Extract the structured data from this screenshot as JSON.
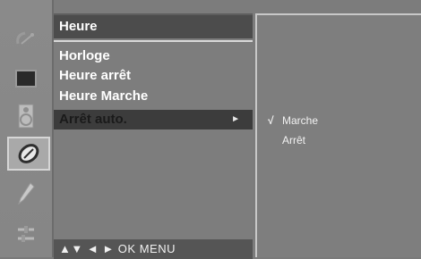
{
  "menu": {
    "title": "Heure",
    "items": [
      {
        "label": "Horloge"
      },
      {
        "label": "Heure arrêt"
      },
      {
        "label": "Heure Marche"
      },
      {
        "label": "Arrêt auto.",
        "selected": true,
        "arrow": "►"
      }
    ],
    "nav_hint": "▲▼  ◄ ►  OK  MENU"
  },
  "submenu": {
    "check_mark": "√",
    "options": [
      {
        "label": "Marche",
        "checked": true
      },
      {
        "label": "Arrêt",
        "checked": false
      }
    ]
  },
  "sidebar": {
    "icons": [
      "satellite-dish-icon",
      "picture-icon",
      "speaker-icon",
      "timer-icon",
      "special-icon",
      "setup-icon"
    ],
    "active": "timer-icon"
  },
  "colors": {
    "background": "#7c7c7c",
    "title_bar": "#4c4c4c",
    "selected_row": "#3c3c3c",
    "text": "#ffffff"
  }
}
